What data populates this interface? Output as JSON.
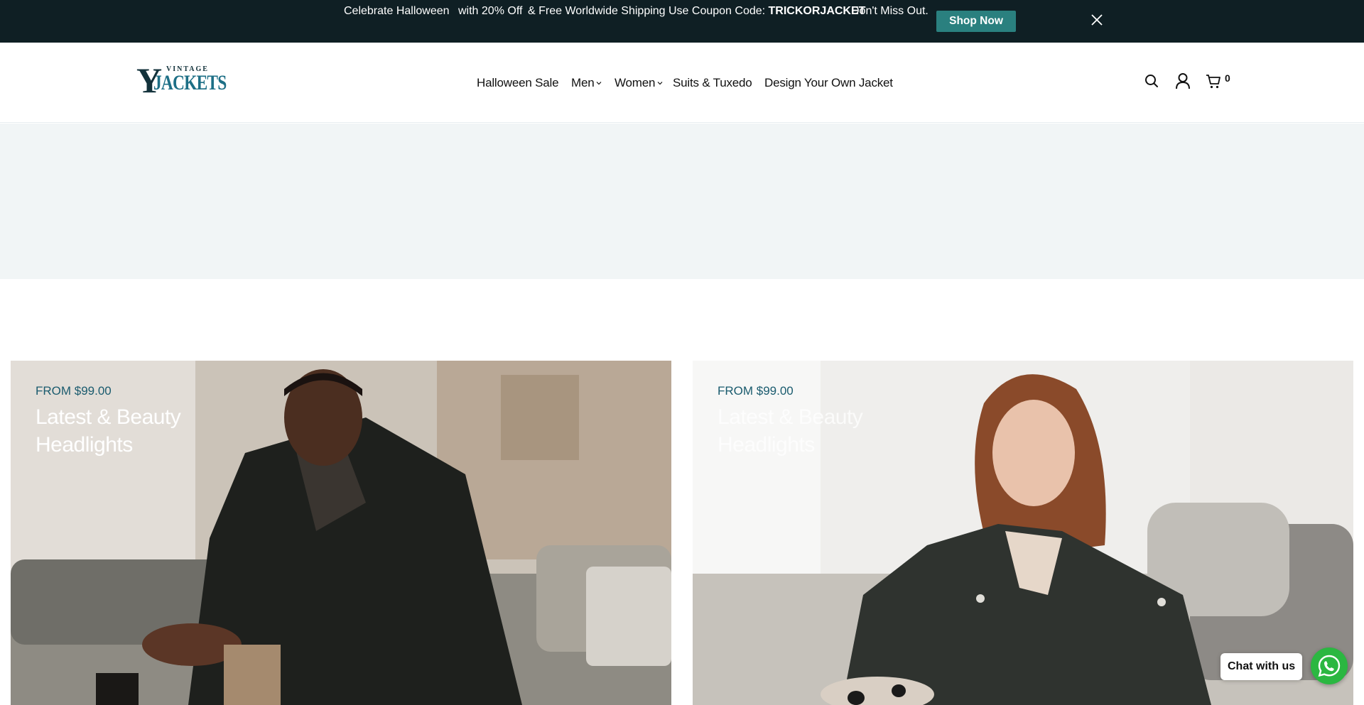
{
  "announcement": {
    "part1": "Celebrate Halloween",
    "part2": "with 20% Off",
    "part3": "& Free Worldwide Shipping",
    "coupon_prefix": "Use Coupon Code: ",
    "coupon_code": "TRICKORJACKET",
    "part4": "Don't Miss Out.",
    "shop_now_label": "Shop Now",
    "close_icon": "close-icon"
  },
  "header": {
    "logo_top": "VINTAGE",
    "logo_y": "Y",
    "logo_main": "JACKETS",
    "nav": [
      {
        "label": "Halloween Sale"
      },
      {
        "label": "Men"
      },
      {
        "label": "Women"
      },
      {
        "label": "Suits & Tuxedo"
      },
      {
        "label": "Design Your Own Jacket"
      }
    ],
    "icons": [
      "search-icon",
      "account-icon",
      "cart-icon"
    ],
    "cart_count": "0"
  },
  "promos": [
    {
      "price": "FROM $99.00",
      "title": "Latest & Beauty Headlights"
    },
    {
      "price": "FROM $99.00",
      "title": "Latest & Beauty Headlights"
    }
  ],
  "chat": {
    "label": "Chat with us",
    "icon": "whatsapp-icon"
  },
  "colors": {
    "announcement_bg": "#0f1f24",
    "accent": "#2a807f",
    "brand_blue": "#1d6f86",
    "whatsapp": "#2bb741"
  }
}
